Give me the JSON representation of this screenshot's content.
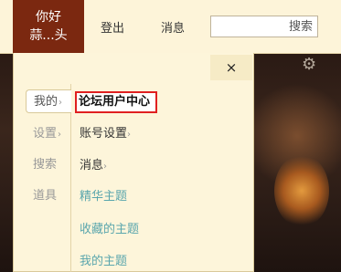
{
  "topbar": {
    "user_line1": "你好",
    "user_line2": "蒜...头",
    "login": "登出",
    "messages": "消息",
    "search_placeholder": "搜索"
  },
  "panel": {
    "close": "×",
    "side": [
      {
        "label": "我的",
        "arrow": "›"
      },
      {
        "label": "设置",
        "arrow": "›"
      },
      {
        "label": "搜索",
        "arrow": ""
      },
      {
        "label": "道具",
        "arrow": ""
      }
    ],
    "items": [
      {
        "label": "论坛用户中心",
        "arrow": ""
      },
      {
        "label": "账号设置",
        "arrow": "›"
      },
      {
        "label": "消息",
        "arrow": "›"
      },
      {
        "label": "精华主题",
        "arrow": ""
      },
      {
        "label": "收藏的主题",
        "arrow": ""
      },
      {
        "label": "我的主题",
        "arrow": ""
      }
    ]
  },
  "icons": {
    "gear": "gear-icon",
    "close": "close-icon"
  },
  "colors": {
    "user_tab": "#7b2810",
    "link": "#5aa6ad",
    "highlight_border": "#e02020"
  }
}
